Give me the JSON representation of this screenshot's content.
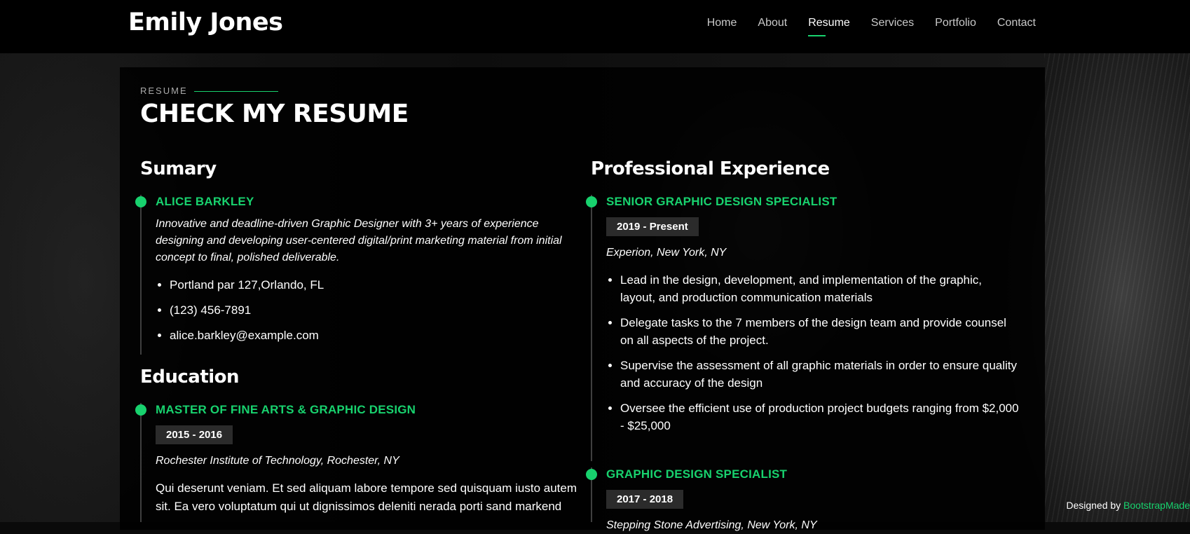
{
  "header": {
    "brand": "Emily Jones",
    "nav": [
      "Home",
      "About",
      "Resume",
      "Services",
      "Portfolio",
      "Contact"
    ],
    "active_index": 2
  },
  "section": {
    "label": "RESUME",
    "title": "CHECK MY RESUME"
  },
  "summary": {
    "heading": "Sumary",
    "name": "ALICE BARKLEY",
    "description": "Innovative and deadline-driven Graphic Designer with 3+ years of experience designing and developing user-centered digital/print marketing material from initial concept to final, polished deliverable.",
    "contacts": [
      "Portland par 127,Orlando, FL",
      "(123) 456-7891",
      "alice.barkley@example.com"
    ]
  },
  "education": {
    "heading": "Education",
    "items": [
      {
        "title": "MASTER OF FINE ARTS & GRAPHIC DESIGN",
        "years": "2015 - 2016",
        "place": "Rochester Institute of Technology, Rochester, NY",
        "description": "Qui deserunt veniam. Et sed aliquam labore tempore sed quisquam iusto autem sit. Ea vero voluptatum qui ut dignissimos deleniti nerada porti sand markend"
      }
    ]
  },
  "experience": {
    "heading": "Professional Experience",
    "items": [
      {
        "title": "SENIOR GRAPHIC DESIGN SPECIALIST",
        "years": "2019 - Present",
        "place": "Experion, New York, NY",
        "bullets": [
          "Lead in the design, development, and implementation of the graphic, layout, and production communication materials",
          "Delegate tasks to the 7 members of the design team and provide counsel on all aspects of the project.",
          "Supervise the assessment of all graphic materials in order to ensure quality and accuracy of the design",
          "Oversee the efficient use of production project budgets ranging from $2,000 - $25,000"
        ]
      },
      {
        "title": "GRAPHIC DESIGN SPECIALIST",
        "years": "2017 - 2018",
        "place": "Stepping Stone Advertising, New York, NY"
      }
    ]
  },
  "footer": {
    "credits_prefix": "Designed by ",
    "credits_link": "BootstrapMade"
  },
  "colors": {
    "accent": "#18d26e",
    "background": "#000000",
    "badge": "#2b2b2b"
  }
}
